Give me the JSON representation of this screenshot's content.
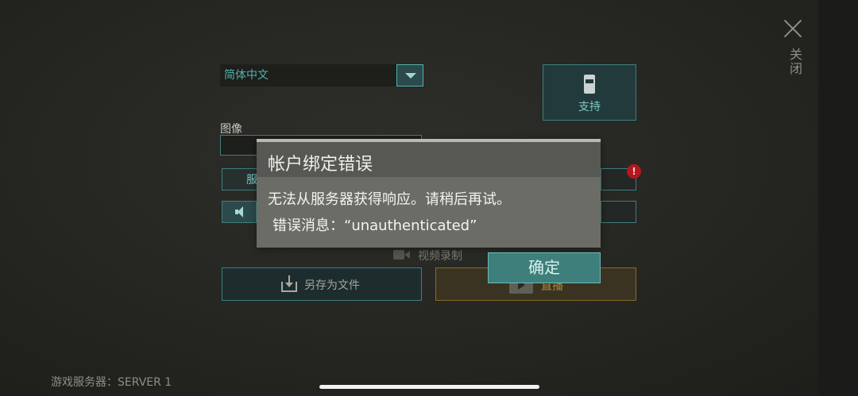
{
  "close": {
    "label": "关闭"
  },
  "language": {
    "selected": "简体中文"
  },
  "support": {
    "label": "支持"
  },
  "image": {
    "label": "图像"
  },
  "server_button": {
    "label": "服"
  },
  "alert": {
    "symbol": "!"
  },
  "video": {
    "label": "视频录制"
  },
  "save": {
    "label": "另存为文件"
  },
  "live": {
    "label": "直播"
  },
  "footer": {
    "server_info": "游戏服务器：SERVER 1"
  },
  "dialog": {
    "title": "帐户绑定错误",
    "message_line1": "无法从服务器获得响应。请稍后再试。",
    "message_line2": "错误消息：“unauthenticated”",
    "confirm_label": "确定"
  },
  "colors": {
    "accent": "#4fb3ae",
    "alert": "#b3171f",
    "live": "#a58a3e"
  }
}
